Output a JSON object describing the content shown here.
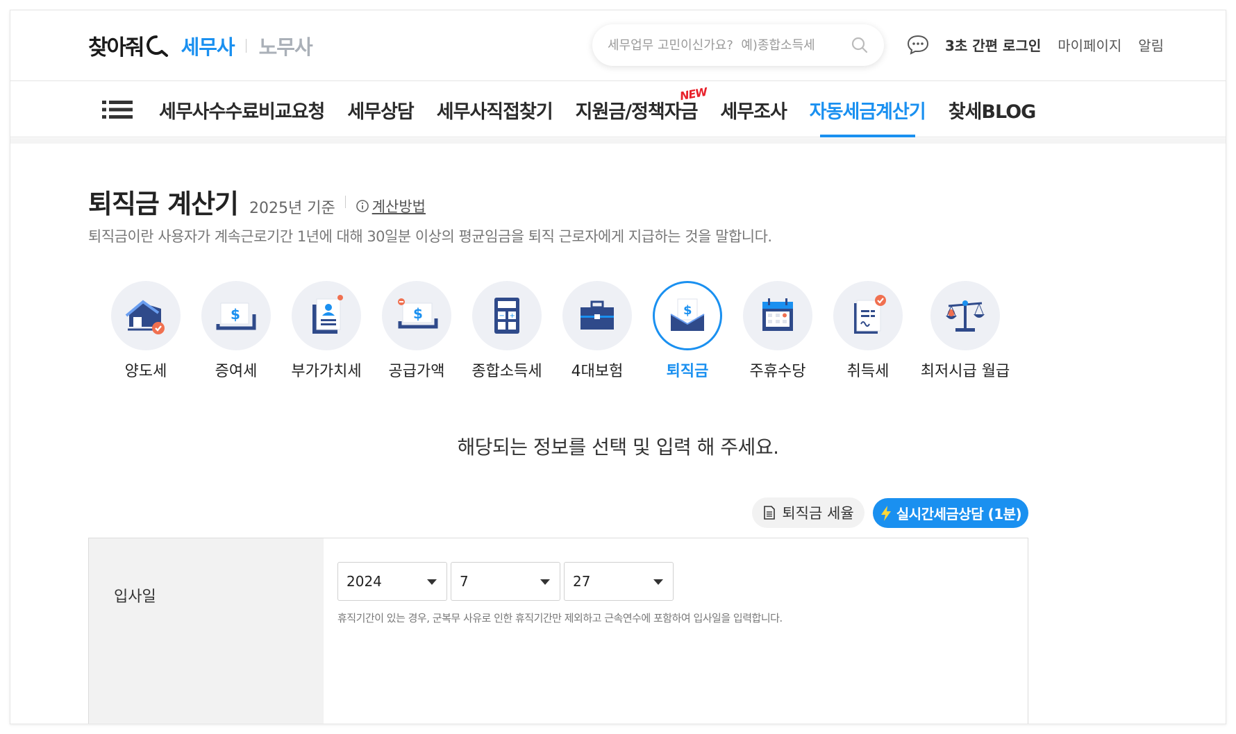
{
  "header": {
    "logo_text": "찾아줘",
    "tab_active": "세무사",
    "tab_inactive": "노무사",
    "search_placeholder": "세무업무 고민이신가요?  예)종합소득세",
    "links": [
      "3초 간편 로그인",
      "마이페이지",
      "알림"
    ]
  },
  "nav": {
    "items": [
      {
        "label": "세무사수수료비교요청"
      },
      {
        "label": "세무상담"
      },
      {
        "label": "세무사직접찾기"
      },
      {
        "label": "지원금/정책자금",
        "badge": "NEW"
      },
      {
        "label": "세무조사"
      },
      {
        "label": "자동세금계산기",
        "active": true
      },
      {
        "label": "찾세BLOG"
      }
    ]
  },
  "page": {
    "title": "퇴직금 계산기",
    "year": "2025년 기준",
    "how_link": "계산방법",
    "description": "퇴직금이란 사용자가 계속근로기간 1년에 대해 30일분 이상의 평균임금을 퇴직 근로자에게 지급하는 것을 말합니다.",
    "prompt": "해당되는 정보를 선택 및 입력 해 주세요."
  },
  "calculators": [
    {
      "label": "양도세",
      "icon": "house-icon"
    },
    {
      "label": "증여세",
      "icon": "money-tray-icon"
    },
    {
      "label": "부가가치세",
      "icon": "document-person-icon"
    },
    {
      "label": "공급가액",
      "icon": "money-card-icon"
    },
    {
      "label": "종합소득세",
      "icon": "calculator-icon"
    },
    {
      "label": "4대보험",
      "icon": "briefcase-icon"
    },
    {
      "label": "퇴직금",
      "icon": "envelope-money-icon",
      "active": true
    },
    {
      "label": "주휴수당",
      "icon": "calendar-icon"
    },
    {
      "label": "취득세",
      "icon": "contract-icon"
    },
    {
      "label": "최저시급 월급",
      "icon": "scale-icon"
    }
  ],
  "actions": {
    "tax_rate": "퇴직금 세율",
    "consult": "실시간세금상담 (1분)"
  },
  "form": {
    "join_date_label": "입사일",
    "year": "2024",
    "month": "7",
    "day": "27",
    "note": "휴직기간이 있는 경우, 군복무 사유로 인한 휴직기간만 제외하고 근속연수에 포함하여 입사일을 입력합니다."
  },
  "colors": {
    "accent": "#1a90f0",
    "badge_red": "#e8202a",
    "icon_navy": "#2f4a8a",
    "icon_orange": "#f07050"
  }
}
